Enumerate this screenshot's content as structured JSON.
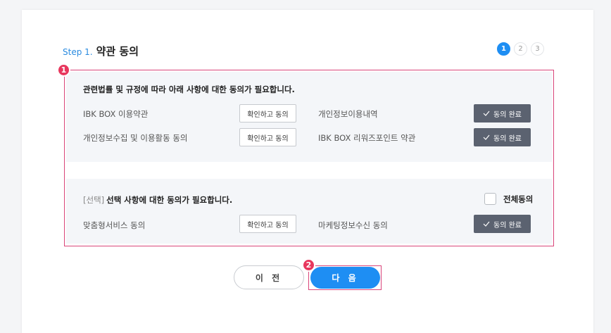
{
  "header": {
    "step_label": "Step 1.",
    "title": "약관 동의",
    "steps": [
      "1",
      "2",
      "3"
    ],
    "active_step": "1"
  },
  "markers": [
    "1",
    "2"
  ],
  "required": {
    "title": "관련법률 및 규정에 따라 아래 사항에 대한 동의가 필요합니다.",
    "items": [
      {
        "label": "IBK BOX 이용약관",
        "button": "확인하고 동의"
      },
      {
        "label": "개인정보이용내역",
        "button": "동의 완료",
        "done": true
      },
      {
        "label": "개인정보수집 및 이용활동 동의",
        "button": "확인하고 동의"
      },
      {
        "label": "IBK BOX 리워즈포인트 약관",
        "button": "동의 완료",
        "done": true
      }
    ]
  },
  "optional": {
    "tag": "[선택]",
    "title": "선택 사항에 대한 동의가 필요합니다.",
    "agree_all_label": "전체동의",
    "agree_all_checked": false,
    "items": [
      {
        "label": "맞춤형서비스 동의",
        "button": "확인하고 동의"
      },
      {
        "label": "마케팅정보수신 동의",
        "button": "동의 완료",
        "done": true
      }
    ]
  },
  "footer": {
    "prev_label": "이 전",
    "next_label": "다 음"
  },
  "colors": {
    "accent": "#1e8ef3",
    "marker": "#e8375d",
    "done_button": "#5b6270"
  }
}
